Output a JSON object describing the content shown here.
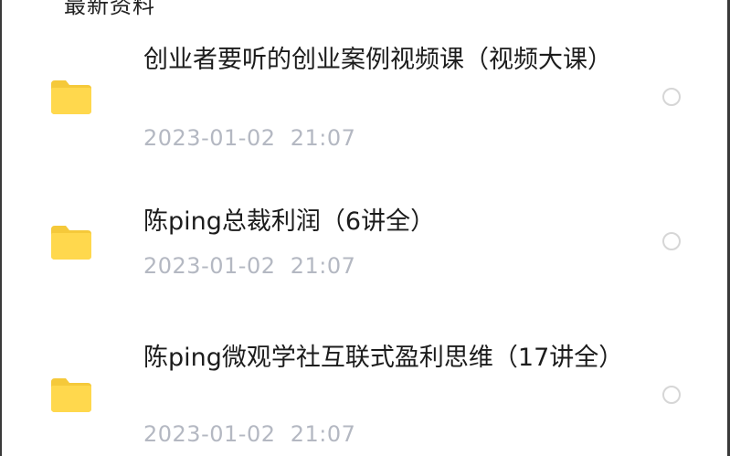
{
  "header": {
    "clipped_text": "最新资料"
  },
  "files": [
    {
      "title": "创业者要听的创业案例视频课（视频大课）",
      "date": "2023-01-02  21:07",
      "icon": "folder-icon",
      "selected": false
    },
    {
      "title": "陈ping总裁利润（6讲全）",
      "date": "2023-01-02  21:07",
      "icon": "folder-icon",
      "selected": false
    },
    {
      "title": "陈ping微观学社互联式盈利思维（17讲全）",
      "date": "2023-01-02  21:07",
      "icon": "folder-icon",
      "selected": false
    }
  ],
  "colors": {
    "folder": "#FFD84D",
    "folder_tab": "#F5C93A",
    "title": "#1c1c1c",
    "date": "#b4b8c2",
    "radio_border": "#d6d6d6"
  }
}
